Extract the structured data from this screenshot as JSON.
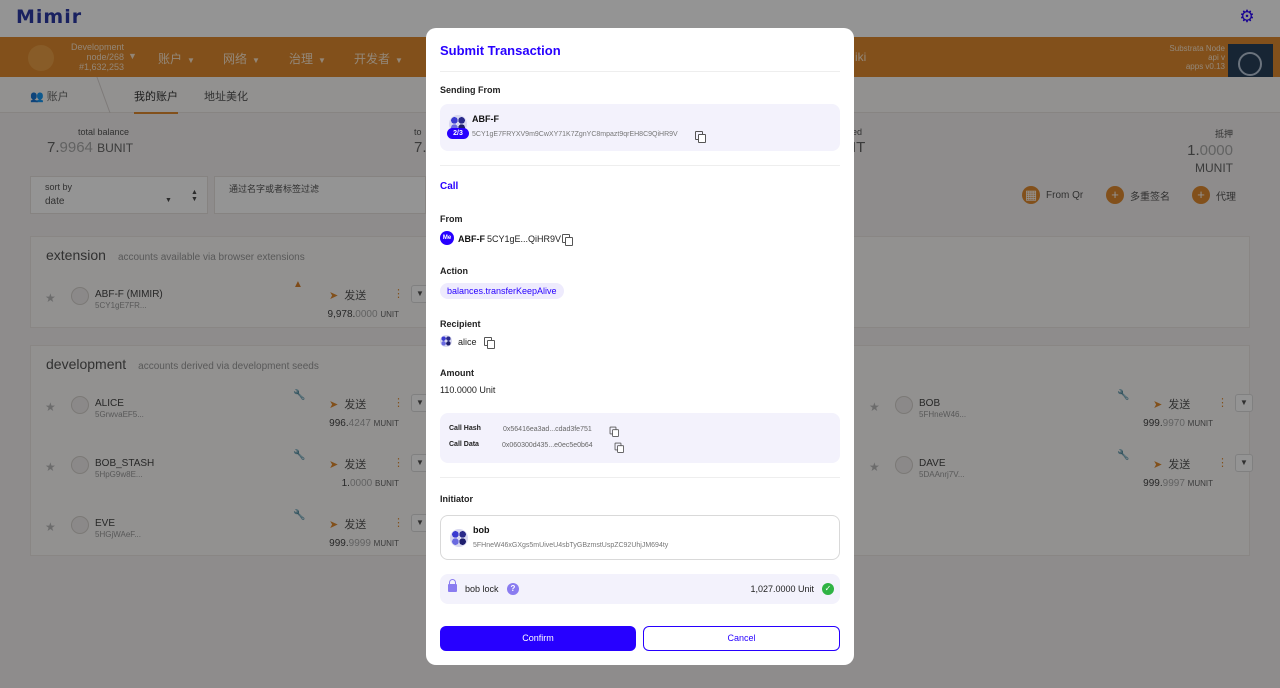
{
  "brand": {
    "logo_text": "Mimir",
    "settings_icon": "gear-icon"
  },
  "chain": {
    "name": "Development",
    "node": "node/268",
    "block": "#1,632,253"
  },
  "nav": {
    "items": [
      "账户",
      "网络",
      "治理",
      "开发者"
    ],
    "wiki": "iki"
  },
  "node_info": {
    "line1": "Substrata Node",
    "line2": "api v",
    "line3": "apps v0.13"
  },
  "subnav": {
    "section": "账户",
    "tabs": [
      "我的账户",
      "地址美化"
    ]
  },
  "summary": {
    "total_label": "total balance",
    "total_int": "7.",
    "total_dec": "9964",
    "total_unit": "BUNIT",
    "mid_label": "to",
    "mid_value": "7.",
    "mid2_label": "ed",
    "mid2_value": "IT",
    "bond_label": "抵押",
    "bond_int": "1.",
    "bond_dec": "0000",
    "bond_unit": "MUNIT"
  },
  "filters": {
    "sort_label": "sort by",
    "sort_value": "date",
    "search_label": "通过名字或者标签过滤"
  },
  "actions": {
    "from_qr": "From Qr",
    "multisig": "多重签名",
    "proxy": "代理"
  },
  "sections": {
    "extension": {
      "title": "extension",
      "subtitle": "accounts available via browser extensions"
    },
    "development": {
      "title": "development",
      "subtitle": "accounts derived via development seeds"
    }
  },
  "accounts": {
    "send_label": "发送",
    "ext": {
      "name": "ABF-F (MIMIR)",
      "addr": "5CY1gE7FR...",
      "bal_int": "9,978.",
      "bal_dec": "0000",
      "unit": "UNIT"
    },
    "alice": {
      "name": "ALICE",
      "addr": "5GrwvaEF5...",
      "bal_int": "996.",
      "bal_dec": "4247",
      "unit": "MUNIT"
    },
    "bob_stash": {
      "name": "BOB_STASH",
      "addr": "5HpG9w8E...",
      "bal_int": "1.",
      "bal_dec": "0000",
      "unit": "BUNIT"
    },
    "eve": {
      "name": "EVE",
      "addr": "5HGjWAeF...",
      "bal_int": "999.",
      "bal_dec": "9999",
      "unit": "MUNIT"
    },
    "bob": {
      "name": "BOB",
      "addr": "5FHneW46...",
      "bal_int": "999.",
      "bal_dec": "9970",
      "unit": "MUNIT"
    },
    "dave": {
      "name": "DAVE",
      "addr": "5DAAnrj7V...",
      "bal_int": "999.",
      "bal_dec": "9997",
      "unit": "MUNIT"
    }
  },
  "modal": {
    "title": "Submit Transaction",
    "sending_from_label": "Sending From",
    "sender_name": "ABF-F",
    "sender_addr": "5CY1gE7FRYXV9m9CwXY71K7ZgnYC8mpazt9qrEH8C9QiHR9V",
    "multisig_badge": "2/3",
    "call_label": "Call",
    "from_label": "From",
    "from_badge": "Me",
    "from_name": "ABF-F",
    "from_addr": "5CY1gE...QiHR9V",
    "action_label": "Action",
    "action_value": "balances.transferKeepAlive",
    "recipient_label": "Recipient",
    "recipient_name": "alice",
    "amount_label": "Amount",
    "amount_value": "110.0000 Unit",
    "call_hash_label": "Call Hash",
    "call_hash_value": "0x56416ea3ad...cdad3fe751",
    "call_data_label": "Call Data",
    "call_data_value": "0x060300d435...e0ec5e0b64",
    "initiator_label": "Initiator",
    "initiator_name": "bob",
    "initiator_addr": "5FHneW46xGXgs5mUiveU4sbTyGBzmstUspZC92UhjJM694ty",
    "lock_label": "bob lock",
    "lock_amount": "1,027.0000 Unit",
    "confirm_label": "Confirm",
    "cancel_label": "Cancel"
  }
}
